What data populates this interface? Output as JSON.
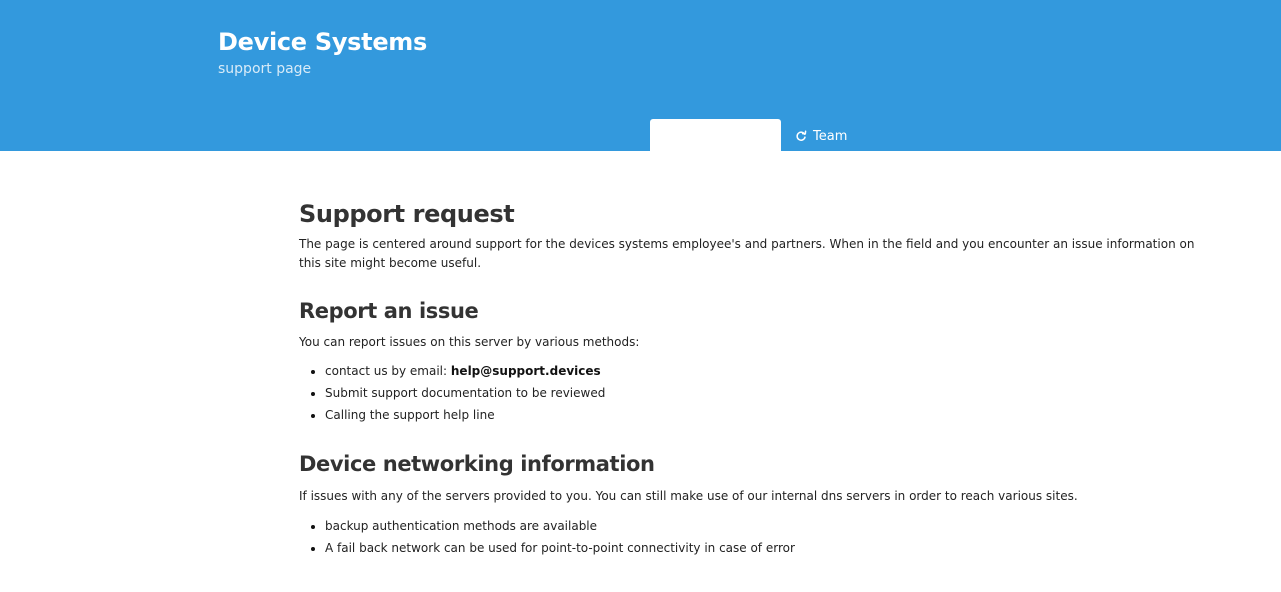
{
  "header": {
    "title": "Device Systems",
    "subtitle": "support page",
    "background_color": "#3399dd"
  },
  "tabs": [
    {
      "label": "",
      "active": true
    },
    {
      "label": "Team",
      "icon": "refresh-icon",
      "active": false
    }
  ],
  "main": {
    "title": "Support request",
    "intro": "The page is centered around support for the devices systems employee's and partners. When in the field and you encounter an issue information on this site might become useful.",
    "report": {
      "heading": "Report an issue",
      "intro": "You can report issues on this server by various methods:",
      "items": [
        {
          "prefix": "contact us by email: ",
          "email": "help@support.devices"
        },
        {
          "text": "Submit support documentation to be reviewed"
        },
        {
          "text": "Calling the support help line"
        }
      ]
    },
    "networking": {
      "heading": "Device networking information",
      "intro": "If issues with any of the servers provided to you. You can still make use of our internal dns servers in order to reach various sites.",
      "items": [
        "backup authentication methods are available",
        "A fail back network can be used for point-to-point connectivity in case of error"
      ]
    }
  }
}
